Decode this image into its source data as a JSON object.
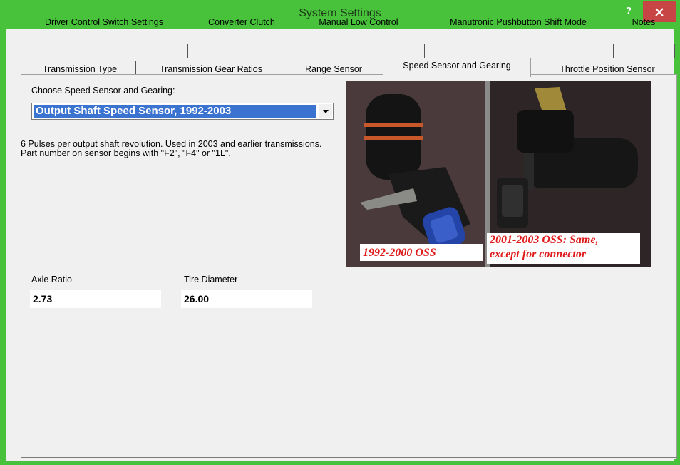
{
  "window": {
    "title": "System Settings",
    "help_label": "?",
    "close_label": "×"
  },
  "tabs_row1": [
    {
      "label": "Driver Control Switch Settings"
    },
    {
      "label": "Converter Clutch"
    },
    {
      "label": "Manual Low Control"
    },
    {
      "label": "Manutronic Pushbutton Shift Mode"
    },
    {
      "label": "Notes"
    }
  ],
  "tabs_row2": [
    {
      "label": "Transmission Type"
    },
    {
      "label": "Transmission Gear Ratios"
    },
    {
      "label": "Range Sensor"
    },
    {
      "label": "Speed Sensor and Gearing",
      "active": true
    },
    {
      "label": "Throttle Position Sensor"
    }
  ],
  "panel": {
    "choose_label": "Choose Speed Sensor and Gearing:",
    "selected_sensor": "Output Shaft Speed Sensor, 1992-2003",
    "description": "6 Pulses per output shaft revolution. Used in 2003 and earlier transmissions. Part number on sensor begins with \"F2\", \"F4\" or \"1L\".",
    "photo": {
      "caption_left": "1992-2000 OSS",
      "caption_right_line1": "2001-2003 OSS: Same,",
      "caption_right_line2": "except for connector"
    },
    "axle_ratio": {
      "label": "Axle Ratio",
      "value": "2.73"
    },
    "tire_diameter": {
      "label": "Tire Diameter",
      "value": "26.00"
    }
  },
  "colors": {
    "title_bar": "#47c23a",
    "close_button": "#c74645",
    "selection": "#3b73d1",
    "caption_text": "#e01b1b"
  }
}
